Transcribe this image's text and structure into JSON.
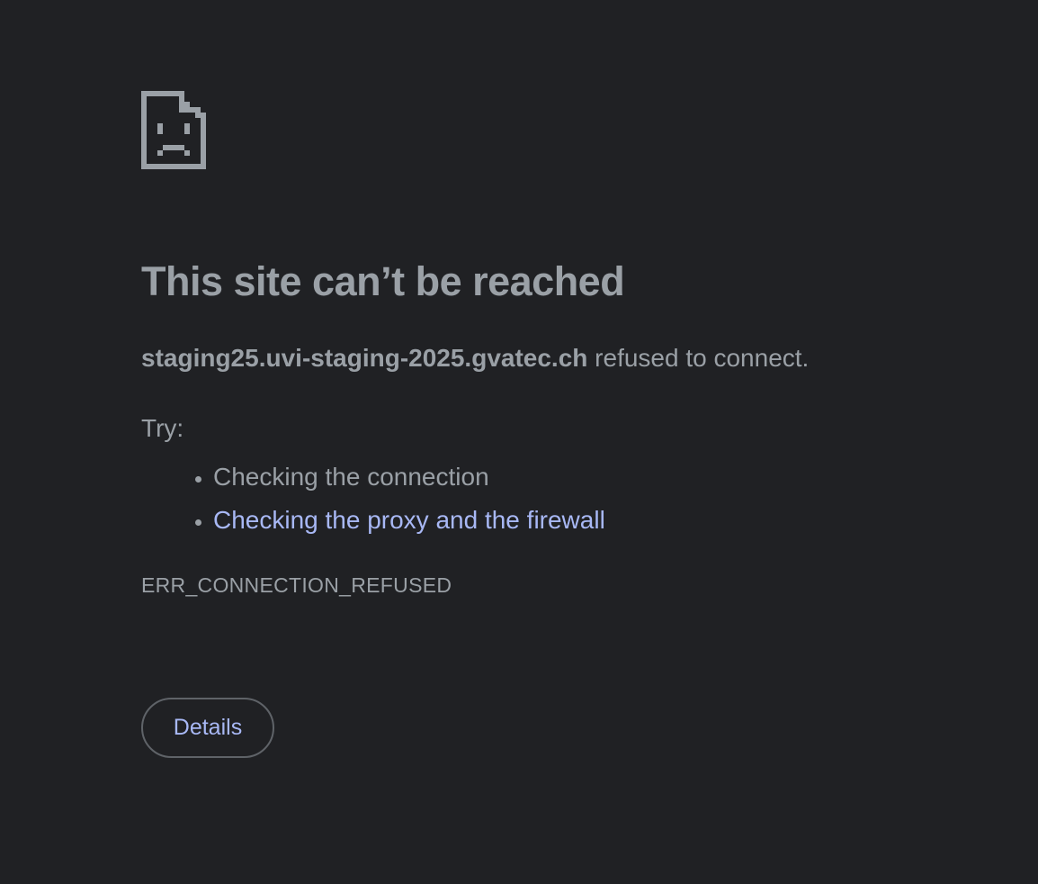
{
  "error_page": {
    "icon": "sad-document-icon",
    "title": "This site can’t be reached",
    "summary": {
      "host": "staging25.uvi-staging-2025.gvatec.ch",
      "message": " refused to connect."
    },
    "try_label": "Try:",
    "suggestions": [
      "Checking the connection",
      "Checking the proxy and the firewall"
    ],
    "error_code": "ERR_CONNECTION_REFUSED",
    "details_button": "Details"
  },
  "colors": {
    "background": "#202124",
    "text": "#9aa0a6",
    "link": "#a8b8f5",
    "button_border": "#5f6368"
  }
}
